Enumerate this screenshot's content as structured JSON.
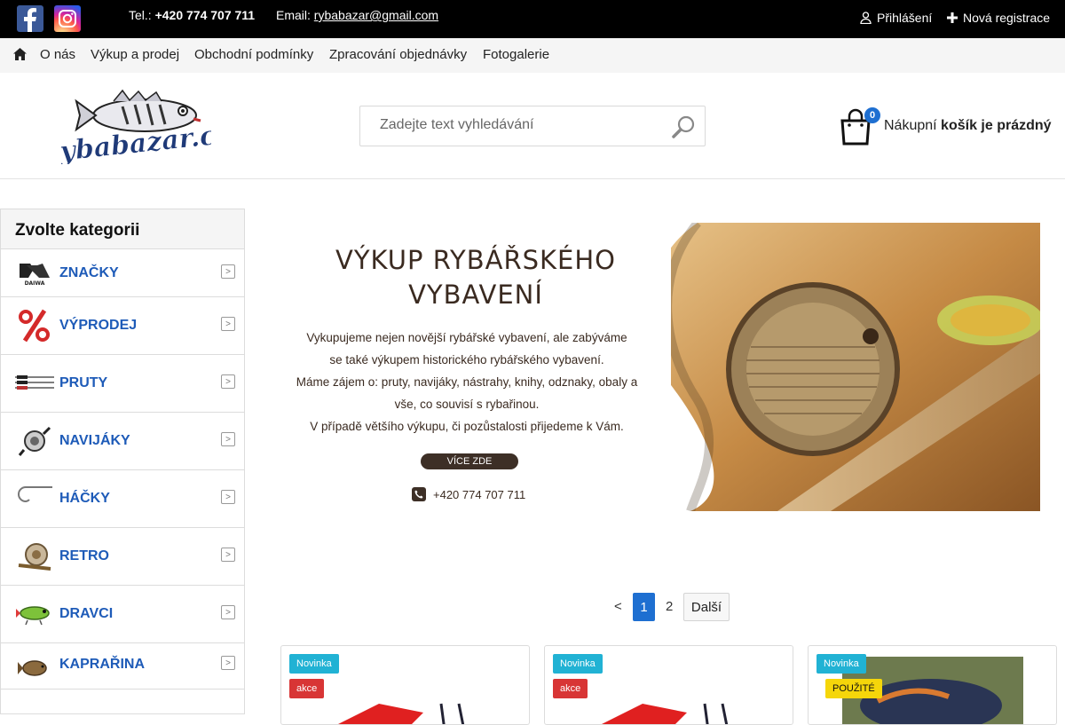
{
  "topbar": {
    "tel_label": "Tel.:",
    "tel": "+420 774 707 711",
    "email_label": "Email:",
    "email": "rybabazar@gmail.com",
    "login": "Přihlášení",
    "register": "Nová registrace"
  },
  "nav": {
    "items": [
      "O nás",
      "Výkup a prodej",
      "Obchodní podmínky",
      "Zpracování objednávky",
      "Fotogalerie"
    ]
  },
  "header": {
    "logo_text": "Rybabazar.cz",
    "search_placeholder": "Zadejte text vyhledávání",
    "cart_count": "0",
    "cart_text_1": "Nákupní",
    "cart_text_2": "košík je prázdný"
  },
  "sidebar": {
    "title": "Zvolte kategorii",
    "categories": [
      {
        "label": "ZNAČKY",
        "icon": "daiwa-logo-icon"
      },
      {
        "label": "VÝPRODEJ",
        "icon": "percent-icon"
      },
      {
        "label": "PRUTY",
        "icon": "rod-icon"
      },
      {
        "label": "NAVIJÁKY",
        "icon": "reel-icon"
      },
      {
        "label": "HÁČKY",
        "icon": "hook-icon"
      },
      {
        "label": "RETRO",
        "icon": "retro-reel-icon"
      },
      {
        "label": "DRAVCI",
        "icon": "lure-icon"
      },
      {
        "label": "KAPRAŘINA",
        "icon": "carp-icon"
      }
    ]
  },
  "banner": {
    "heading_1": "VÝKUP RYBÁŘSKÉHO",
    "heading_2": "VYBAVENÍ",
    "lines": [
      "Vykupujeme nejen novější rybářské vybavení, ale zabýváme",
      "se také výkupem historického rybářského vybavení.",
      "Máme zájem o: pruty, navijáky, nástrahy, knihy, odznaky, obaly a",
      "vše, co souvisí s rybařinou.",
      "V případě většího výkupu, či pozůstalosti přijedeme k Vám."
    ],
    "button": "VÍCE ZDE",
    "phone": "+420 774 707 711"
  },
  "pagination": {
    "prev": "<",
    "page1": "1",
    "page2": "2",
    "next": "Další"
  },
  "products": [
    {
      "badge1": "Novinka",
      "badge2": "akce"
    },
    {
      "badge1": "Novinka",
      "badge2": "akce"
    },
    {
      "badge1": "Novinka",
      "badge2": "POUŽITÉ"
    }
  ],
  "colors": {
    "topbar": "#000000",
    "link_blue": "#1e5bb8",
    "accent_blue": "#1e6fd1",
    "badge_new": "#21b2d4",
    "badge_sale": "#d83535",
    "badge_used": "#f5d60a"
  }
}
